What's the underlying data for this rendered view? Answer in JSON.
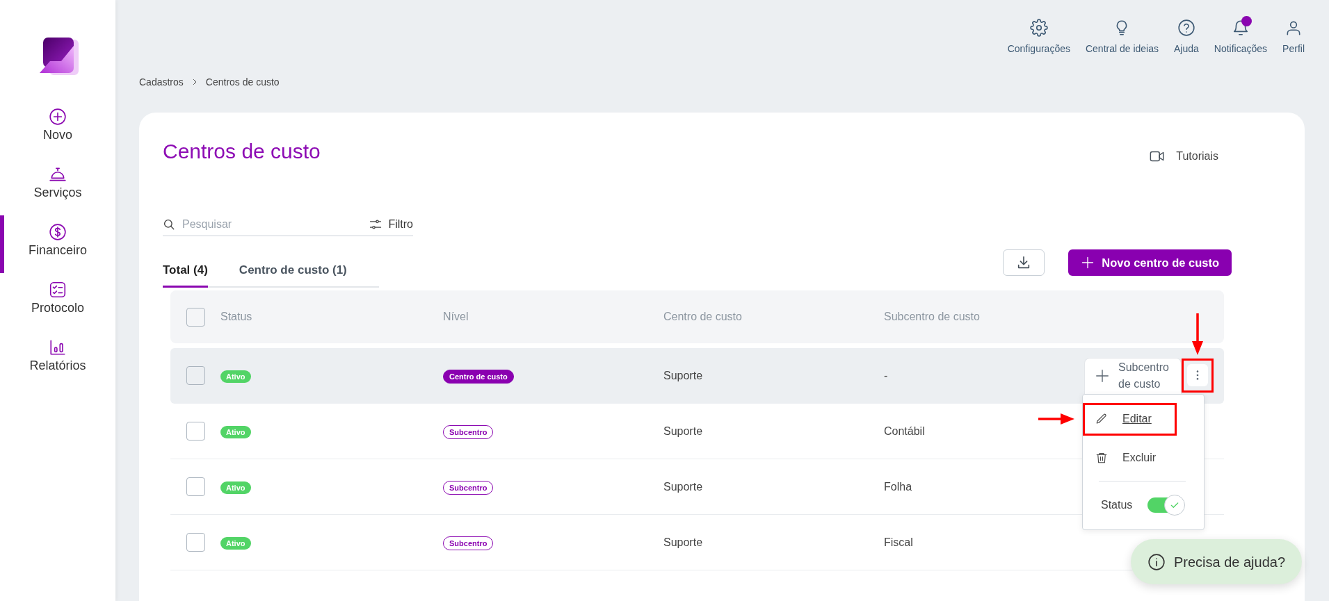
{
  "sidebar": {
    "items": [
      {
        "label": "Novo",
        "selected": false
      },
      {
        "label": "Serviços",
        "selected": false
      },
      {
        "label": "Financeiro",
        "selected": true
      },
      {
        "label": "Protocolo",
        "selected": false
      },
      {
        "label": "Relatórios",
        "selected": false
      }
    ]
  },
  "top_bar": {
    "items": [
      {
        "label": "Configurações",
        "badge": false
      },
      {
        "label": "Central de ideias",
        "badge": false
      },
      {
        "label": "Ajuda",
        "badge": false
      },
      {
        "label": "Notificações",
        "badge": true
      },
      {
        "label": "Perfil",
        "badge": false
      }
    ]
  },
  "breadcrumb": [
    "Cadastros",
    "Centros de custo"
  ],
  "page": {
    "title": "Centros de custo",
    "tutorials_link": "Tutoriais",
    "search": {
      "placeholder": "Pesquisar"
    },
    "filter_button": "Filtro",
    "tabs": [
      {
        "label": "Total (4)",
        "selected": true
      },
      {
        "label": "Centro de custo (1)",
        "selected": false
      }
    ],
    "new_button": "Novo centro de custo"
  },
  "table": {
    "header_checked": false,
    "columns": [
      "Status",
      "Nível",
      "Centro de custo",
      "Subcentro de custo"
    ],
    "rows": [
      {
        "checked": false,
        "active": true,
        "status": "Ativo",
        "nivel": {
          "label": "Centro de custo",
          "kind": "filled"
        },
        "cost_center": "Suporte",
        "subcenter": "-"
      },
      {
        "checked": false,
        "active": false,
        "status": "Ativo",
        "nivel": {
          "label": "Subcentro",
          "kind": "outline"
        },
        "cost_center": "Suporte",
        "subcenter": "Contábil"
      },
      {
        "checked": false,
        "active": false,
        "status": "Ativo",
        "nivel": {
          "label": "Subcentro",
          "kind": "outline"
        },
        "cost_center": "Suporte",
        "subcenter": "Folha"
      },
      {
        "checked": false,
        "active": false,
        "status": "Ativo",
        "nivel": {
          "label": "Subcentro",
          "kind": "outline"
        },
        "cost_center": "Suporte",
        "subcenter": "Fiscal"
      }
    ]
  },
  "row_actions": {
    "add_button": "Subcentro de custo",
    "more_highlighted": true,
    "menu_expanded": true,
    "menu": {
      "items": [
        {
          "kind": "edit",
          "label": "Editar",
          "highlighted": true
        },
        {
          "kind": "delete",
          "label": "Excluir",
          "highlighted": false
        }
      ],
      "status_label": "Status",
      "status_on": true
    }
  },
  "help_button": "Precisa de ajuda?"
}
